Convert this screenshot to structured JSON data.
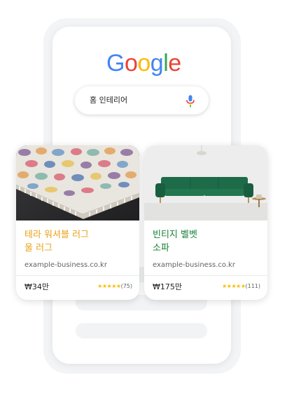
{
  "logo": {
    "letters": [
      "G",
      "o",
      "o",
      "g",
      "l",
      "e"
    ],
    "colors": [
      "#4285F4",
      "#EA4335",
      "#FBBC05",
      "#4285F4",
      "#34A853",
      "#EA4335"
    ]
  },
  "search": {
    "query": "홈 인테리어",
    "mic_icon": "microphone-icon"
  },
  "products": [
    {
      "title": "테라 워셔블 러그\n울 러그",
      "title_color": "#E8A317",
      "domain": "example-business.co.kr",
      "price": "₩34만",
      "stars": "★★★★★",
      "reviews": "(75)",
      "image": "rug-image"
    },
    {
      "title": "빈티지 벨벳\n소파",
      "title_color": "#188038",
      "domain": "example-business.co.kr",
      "price": "₩175만",
      "stars": "★★★★★",
      "reviews": "(111)",
      "image": "sofa-image"
    }
  ],
  "colors": {
    "star": "#FBBC04",
    "sofa": "#1E6B4A"
  }
}
